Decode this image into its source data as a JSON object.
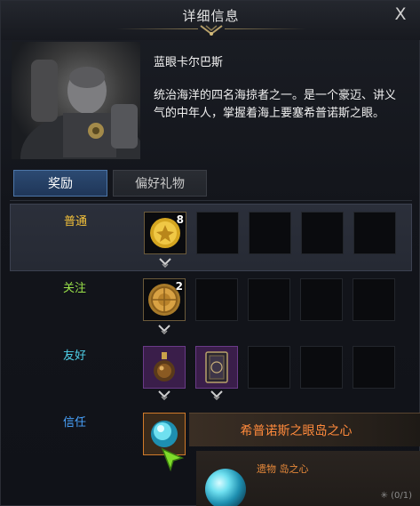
{
  "header": {
    "title": "详细信息",
    "close_label": "X"
  },
  "character": {
    "name": "蓝眼卡尔巴斯",
    "description": "统治海洋的四名海掠者之一。是一个豪迈、讲义气的中年人，掌握着海上要塞希普诺斯之眼。"
  },
  "tabs": [
    {
      "label": "奖励",
      "active": true
    },
    {
      "label": "偏好礼物",
      "active": false
    }
  ],
  "tiers": [
    {
      "label": "普通",
      "color": "#f5c23a",
      "slots": [
        {
          "item": "gold-coin",
          "count": "8"
        }
      ]
    },
    {
      "label": "关注",
      "color": "#9be34a",
      "slots": [
        {
          "item": "gold-medallion",
          "count": "2"
        }
      ]
    },
    {
      "label": "友好",
      "color": "#4fd0e8",
      "slots": [
        {
          "item": "potion-flask"
        },
        {
          "item": "card"
        }
      ]
    },
    {
      "label": "信任",
      "color": "#4aa4ff",
      "slots": [
        {
          "item": "island-orb"
        }
      ]
    }
  ],
  "tooltip": {
    "title": "希普诺斯之眼岛之心",
    "subtitle": "遗物 岛之心"
  },
  "watermark": "✳ (0/1)"
}
